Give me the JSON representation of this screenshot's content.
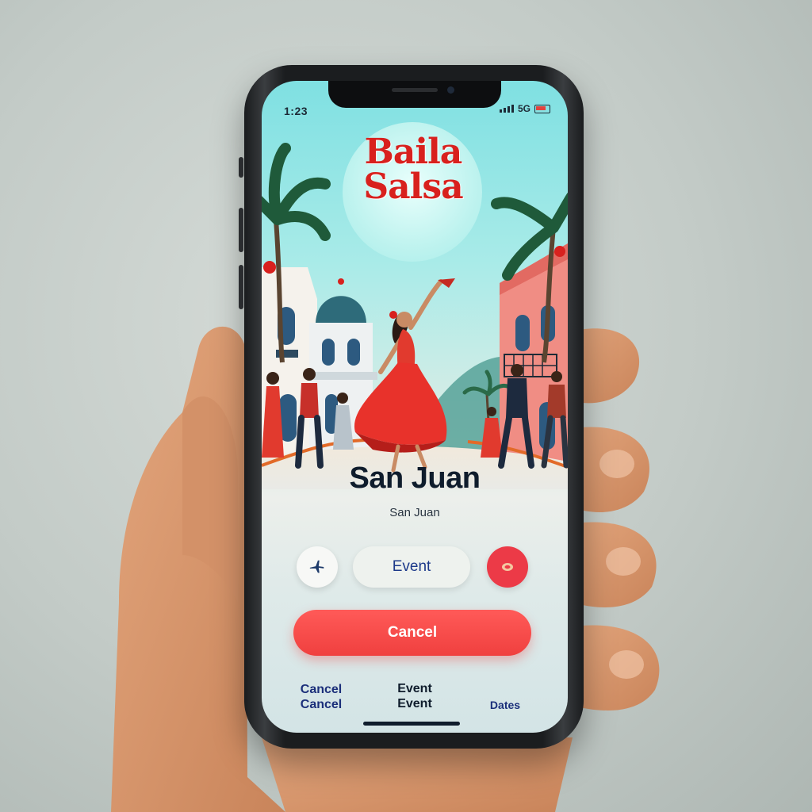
{
  "status_bar": {
    "time": "1:23",
    "signal_text": "5G"
  },
  "app": {
    "title_line1": "Baila",
    "title_line2": "Salsa"
  },
  "location": {
    "name": "San Juan",
    "subtitle": "San Juan"
  },
  "actions": {
    "event_label": "Event",
    "plane_icon": "airplane-icon",
    "ring_icon": "ring-icon"
  },
  "primary_button": {
    "label": "Cancel"
  },
  "bottom_nav": {
    "cancel_line1": "Cancel",
    "cancel_line2": "Cancel",
    "event_line1": "Event",
    "event_line2": "Event",
    "dates_label": "Dates"
  },
  "colors": {
    "accent": "#f0403f",
    "title_red": "#d8211e",
    "sky": "#7fe0e2",
    "text_dark": "#0f1c2c"
  }
}
